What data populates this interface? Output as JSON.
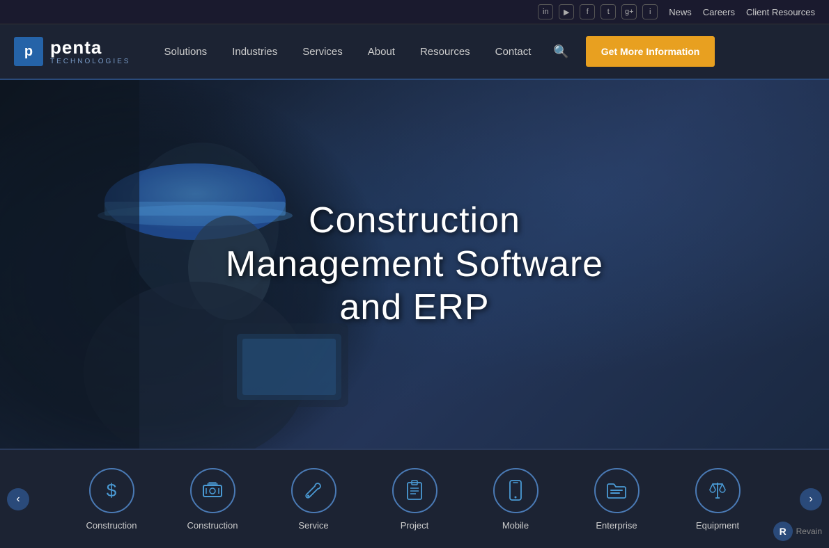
{
  "topbar": {
    "social_icons": [
      {
        "name": "linkedin-icon",
        "symbol": "in"
      },
      {
        "name": "youtube-icon",
        "symbol": "▶"
      },
      {
        "name": "facebook-icon",
        "symbol": "f"
      },
      {
        "name": "twitter-icon",
        "symbol": "t"
      },
      {
        "name": "googleplus-icon",
        "symbol": "g+"
      },
      {
        "name": "other-icon",
        "symbol": "i"
      }
    ],
    "links": [
      "News",
      "Careers",
      "Client Resources"
    ]
  },
  "header": {
    "logo": {
      "box_letter": "p",
      "brand": "penta",
      "sub": "TECHNOLOGIES"
    },
    "nav_items": [
      {
        "label": "Solutions",
        "id": "solutions"
      },
      {
        "label": "Industries",
        "id": "industries"
      },
      {
        "label": "Services",
        "id": "services"
      },
      {
        "label": "About",
        "id": "about"
      },
      {
        "label": "Resources",
        "id": "resources"
      },
      {
        "label": "Contact",
        "id": "contact"
      }
    ],
    "cta_label": "Get More Information"
  },
  "hero": {
    "title_line1": "Construction",
    "title_line2": "Management Software",
    "title_line3": "and ERP"
  },
  "bottom_strip": {
    "items": [
      {
        "label": "Construction",
        "icon": "💲",
        "icon_name": "dollar-icon"
      },
      {
        "label": "Construction",
        "icon": "💰",
        "icon_name": "money-icon"
      },
      {
        "label": "Service",
        "icon": "🔧",
        "icon_name": "wrench-icon"
      },
      {
        "label": "Project",
        "icon": "📋",
        "icon_name": "clipboard-icon"
      },
      {
        "label": "Mobile",
        "icon": "📱",
        "icon_name": "mobile-icon"
      },
      {
        "label": "Enterprise",
        "icon": "🗂",
        "icon_name": "folder-icon"
      },
      {
        "label": "Equipment",
        "icon": "⚖",
        "icon_name": "scale-icon"
      }
    ],
    "prev_label": "‹",
    "next_label": "›"
  },
  "revain": {
    "letter": "R",
    "text": "Revain"
  }
}
